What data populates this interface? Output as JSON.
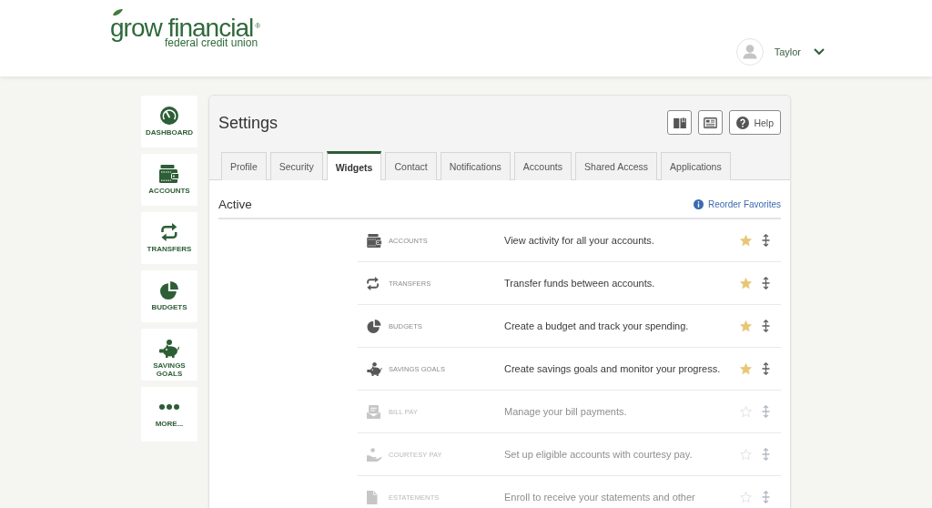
{
  "header": {
    "logo": {
      "wordmark": "grow financial$^{®}$",
      "tagline": "federal credit union"
    },
    "user": {
      "name": "Taylor"
    }
  },
  "sidebar": {
    "items": [
      {
        "label": "DASHBOARD"
      },
      {
        "label": "ACCOUNTS"
      },
      {
        "label": "TRANSFERS"
      },
      {
        "label": "BUDGETS"
      },
      {
        "label": "SAVINGS GOALS"
      },
      {
        "label": "MORE..."
      }
    ]
  },
  "settings": {
    "title": "Settings",
    "help_button": "Help",
    "tabs": [
      {
        "label": "Profile",
        "selected": false
      },
      {
        "label": "Security",
        "selected": false
      },
      {
        "label": "Widgets",
        "selected": true
      },
      {
        "label": "Contact",
        "selected": false
      },
      {
        "label": "Notifications",
        "selected": false
      },
      {
        "label": "Accounts",
        "selected": false
      },
      {
        "label": "Shared Access",
        "selected": false
      },
      {
        "label": "Applications",
        "selected": false
      }
    ],
    "section": {
      "heading": "Active",
      "link": "Reorder Favorites",
      "widgets": [
        {
          "label": "ACCOUNTS",
          "description": "View activity for all your accounts.",
          "favorite": true
        },
        {
          "label": "TRANSFERS",
          "description": "Transfer funds between accounts.",
          "favorite": true
        },
        {
          "label": "BUDGETS",
          "description": "Create a budget and track your spending.",
          "favorite": true
        },
        {
          "label": "SAVINGS GOALS",
          "description": "Create savings goals and monitor your progress.",
          "favorite": true
        },
        {
          "label": "BILL PAY",
          "description": "Manage your bill payments.",
          "favorite": false
        },
        {
          "label": "COURTESY PAY",
          "description": "Set up eligible accounts with courtesy pay.",
          "favorite": false
        },
        {
          "label": "ESTATEMENTS",
          "description": "Enroll to receive your statements and other",
          "favorite": false
        }
      ]
    }
  }
}
